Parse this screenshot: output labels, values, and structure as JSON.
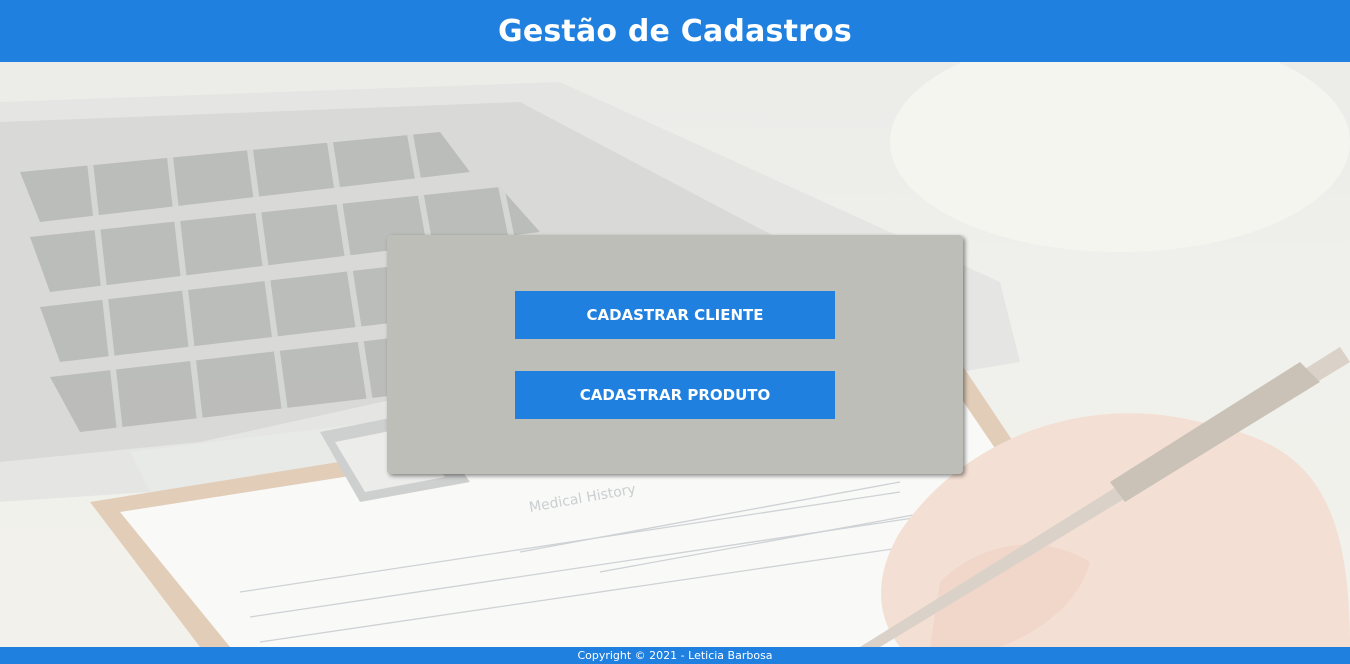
{
  "header": {
    "title": "Gestão de Cadastros"
  },
  "panel": {
    "buttons": [
      {
        "label": "CADASTRAR CLIENTE"
      },
      {
        "label": "CADASTRAR PRODUTO"
      }
    ]
  },
  "footer": {
    "copyright": "Copyright © 2021 - Leticia Barbosa"
  },
  "background": {
    "image": "laptop-and-clipboard-photo"
  },
  "colors": {
    "primary": "#2080e0",
    "panel": "#bebeb8",
    "text_on_primary": "#ffffff"
  }
}
